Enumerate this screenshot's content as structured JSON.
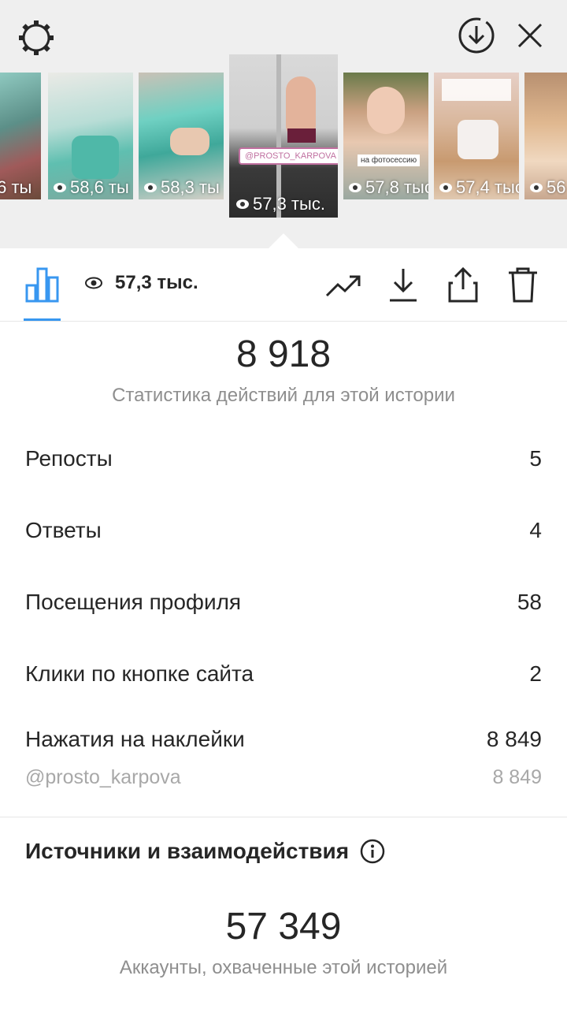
{
  "header": {
    "settings_icon": "gear-icon",
    "download_icon": "download-circle-icon",
    "close_icon": "close-icon"
  },
  "stories": [
    {
      "views": ",6 ты",
      "icon": "eye-icon"
    },
    {
      "views": "58,6 ты",
      "icon": "eye-icon"
    },
    {
      "views": "58,3 ты",
      "icon": "eye-icon"
    },
    {
      "views": "57,3 тыс.",
      "icon": "eye-icon",
      "selected": true,
      "tag": "@PROSTO_KARPOVA"
    },
    {
      "views": "57,8 тыс",
      "icon": "eye-icon",
      "tag": "на фотосессию"
    },
    {
      "views": "57,4 тыс",
      "icon": "eye-icon"
    },
    {
      "views": "56",
      "icon": "eye-icon"
    }
  ],
  "toolbar": {
    "stats_icon": "bar-chart-icon",
    "views": "57,3 тыс.",
    "actions": [
      "trending-icon",
      "download-icon",
      "share-icon",
      "trash-icon"
    ]
  },
  "interactions": {
    "total": "8 918",
    "caption": "Статистика действий для этой истории",
    "rows": [
      {
        "label": "Репосты",
        "value": "5"
      },
      {
        "label": "Ответы",
        "value": "4"
      },
      {
        "label": "Посещения профиля",
        "value": "58"
      },
      {
        "label": "Клики по кнопке сайта",
        "value": "2"
      },
      {
        "label": "Нажатия на наклейки",
        "value": "8 849"
      }
    ],
    "sticker": {
      "label": "@prosto_karpova",
      "value": "8 849"
    }
  },
  "discovery": {
    "title": "Источники и взаимодействия",
    "info_icon": "info-icon",
    "total": "57 349",
    "caption": "Аккаунты, охваченные этой историей"
  },
  "colors": {
    "accent": "#3897f0",
    "text": "#262626",
    "muted": "#8e8e8e"
  }
}
